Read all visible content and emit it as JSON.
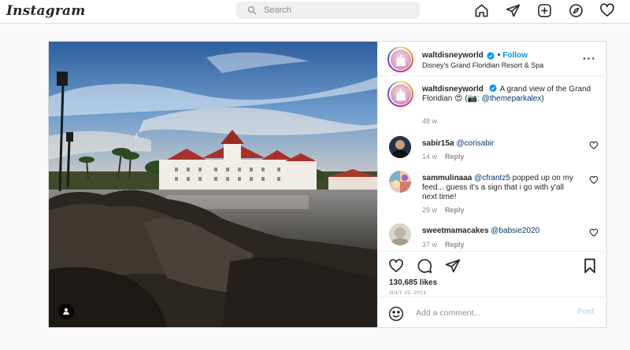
{
  "nav": {
    "logo": "Instagram",
    "search_placeholder": "Search",
    "icons": [
      "home-icon",
      "direct-icon",
      "new-post-icon",
      "explore-icon",
      "activity-heart-icon"
    ]
  },
  "post": {
    "author": {
      "username": "waltdisneyworld",
      "follow_label": "Follow",
      "location": "Disney's Grand Floridian Resort & Spa"
    },
    "caption": {
      "username": "waltdisneyworld",
      "text": "A grand view of the Grand Floridian 😍 (📷:",
      "mention": "@themeparkalex",
      "suffix": ")",
      "time": "48 w"
    },
    "comments": [
      {
        "username": "sabir15a",
        "text": "@corisabir",
        "time": "14 w",
        "reply": "Reply"
      },
      {
        "username": "sammulinaaa",
        "text": "@cfrantz5 popped up on my feed... guess it's a sign that i go with y'all next time!",
        "mention": "@cfrantz5",
        "rest": " popped up on my feed... guess it's a sign that i go with y'all next time!",
        "time": "29 w",
        "reply": "Reply"
      },
      {
        "username": "sweetmamacakes",
        "text": "@babsie2020",
        "time": "37 w",
        "reply": "Reply"
      }
    ],
    "likes": "130,685 likes",
    "date": "JULY 15, 2021",
    "add_comment_placeholder": "Add a comment...",
    "post_label": "Post"
  },
  "colors": {
    "link_blue": "#0095f6",
    "mention_blue": "#00376b",
    "post_disabled": "#b2dffc",
    "muted": "#8e8e8e"
  }
}
